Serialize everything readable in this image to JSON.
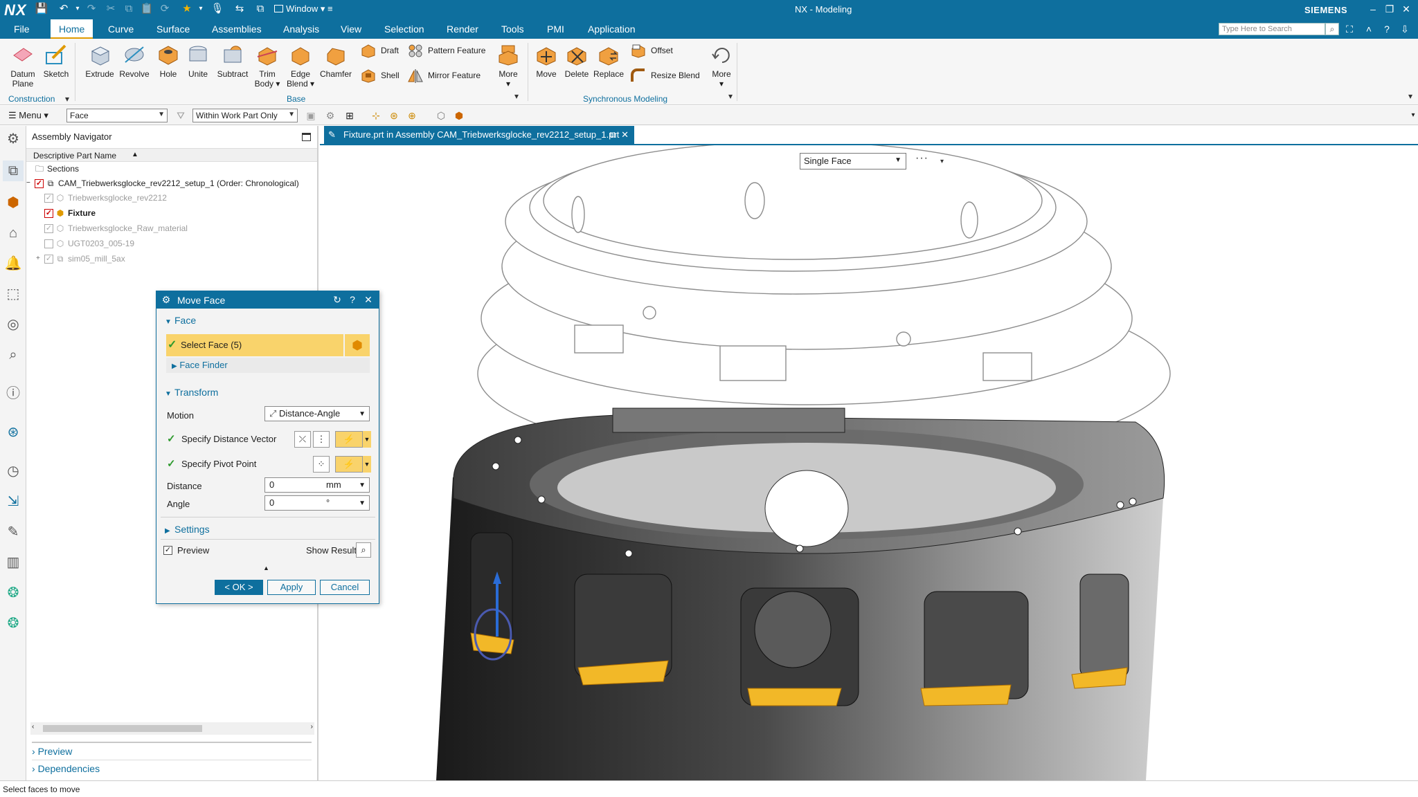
{
  "titlebar": {
    "logo": "NX",
    "window_label": "Window",
    "app_title": "NX - Modeling",
    "brand": "SIEMENS"
  },
  "menu_tabs": [
    "File",
    "Home",
    "Curve",
    "Surface",
    "Assemblies",
    "Analysis",
    "View",
    "Selection",
    "Render",
    "Tools",
    "PMI",
    "Application"
  ],
  "active_tab": "Home",
  "search": {
    "placeholder": "Type Here to Search"
  },
  "ribbon": {
    "datum_plane": "Datum Plane",
    "sketch": "Sketch",
    "extrude": "Extrude",
    "revolve": "Revolve",
    "hole": "Hole",
    "unite": "Unite",
    "subtract": "Subtract",
    "trim_body": "Trim Body",
    "edge_blend": "Edge Blend",
    "chamfer": "Chamfer",
    "draft": "Draft",
    "shell": "Shell",
    "pattern_feature": "Pattern Feature",
    "mirror_feature": "Mirror Feature",
    "more1": "More",
    "move": "Move",
    "delete": "Delete",
    "replace": "Replace",
    "offset": "Offset",
    "resize_blend": "Resize Blend",
    "more2": "More",
    "group_construction": "Construction",
    "group_base": "Base",
    "group_sync": "Synchronous Modeling"
  },
  "selbar": {
    "menu": "Menu",
    "filter": "Face",
    "scope": "Within Work Part Only"
  },
  "navigator": {
    "title": "Assembly Navigator",
    "column": "Descriptive Part Name",
    "rows": [
      {
        "label": "Sections"
      },
      {
        "label": "CAM_Triebwerksglocke_rev2212_setup_1 (Order: Chronological)"
      },
      {
        "label": "Triebwerksglocke_rev2212"
      },
      {
        "label": "Fixture"
      },
      {
        "label": "Triebwerksglocke_Raw_material"
      },
      {
        "label": "UGT0203_005-19"
      },
      {
        "label": "sim05_mill_5ax"
      }
    ],
    "preview": "Preview",
    "dependencies": "Dependencies"
  },
  "dialog": {
    "title": "Move Face",
    "face_section": "Face",
    "select_face": "Select Face (5)",
    "face_finder": "Face Finder",
    "transform_section": "Transform",
    "motion_label": "Motion",
    "motion_value": "Distance-Angle",
    "distance_vector": "Specify Distance Vector",
    "pivot_point": "Specify Pivot Point",
    "distance_label": "Distance",
    "distance_value": "0",
    "distance_unit": "mm",
    "angle_label": "Angle",
    "angle_value": "0",
    "angle_unit": "°",
    "settings_section": "Settings",
    "preview_label": "Preview",
    "show_result": "Show Result",
    "ok": "< OK >",
    "apply": "Apply",
    "cancel": "Cancel"
  },
  "graphics": {
    "tab_title": "Fixture.prt in Assembly CAM_Triebwerksglocke_rev2212_setup_1.prt",
    "face_filter": "Single Face"
  },
  "status": {
    "text": "Select faces to move"
  }
}
